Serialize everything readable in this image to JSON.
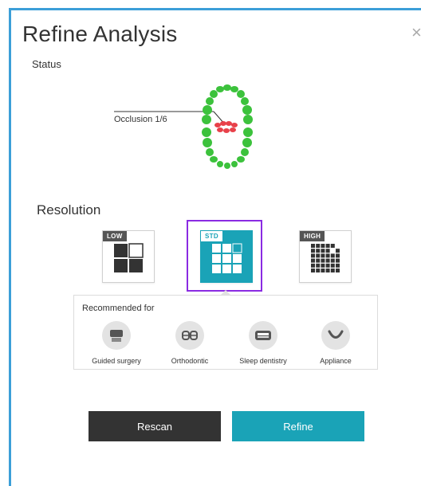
{
  "dialog": {
    "title": "Refine Analysis",
    "close_label": "×"
  },
  "status": {
    "label": "Status",
    "occlusion_label": "Occlusion 1/6"
  },
  "resolution": {
    "label": "Resolution",
    "options": [
      {
        "badge": "LOW"
      },
      {
        "badge": "STD",
        "selected": true
      },
      {
        "badge": "HIGH"
      }
    ]
  },
  "recommended": {
    "title": "Recommended for",
    "items": [
      {
        "label": "Guided surgery",
        "icon": "guided-surgery-icon"
      },
      {
        "label": "Orthodontic",
        "icon": "orthodontic-icon"
      },
      {
        "label": "Sleep dentistry",
        "icon": "sleep-dentistry-icon"
      },
      {
        "label": "Appliance",
        "icon": "appliance-icon"
      }
    ]
  },
  "buttons": {
    "rescan": "Rescan",
    "refine": "Refine"
  },
  "colors": {
    "accent": "#1aa3b7",
    "selected_outline": "#8a2be2",
    "teeth_green": "#3cc23c",
    "teeth_red": "#e8414a",
    "frame_border": "#3c9fd8"
  }
}
